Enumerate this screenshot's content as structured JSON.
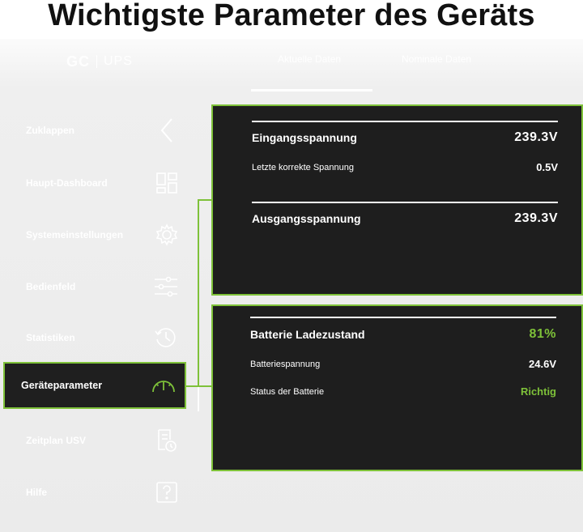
{
  "headline": "Wichtigste Parameter des Geräts",
  "app": {
    "logo_mark": "GC",
    "logo_text": "UPS",
    "tabs": [
      {
        "label": "Aktuelle Daten",
        "active": true
      },
      {
        "label": "Nominale Daten",
        "active": false
      }
    ]
  },
  "sidebar": {
    "items": [
      {
        "label": "Zuklappen",
        "icon": "chevron-left-icon"
      },
      {
        "label": "Haupt-Dashboard",
        "icon": "dashboard-grid-icon"
      },
      {
        "label": "Systemeinstellungen",
        "icon": "gear-icon"
      },
      {
        "label": "Bedienfeld",
        "icon": "sliders-icon"
      },
      {
        "label": "Statistiken",
        "icon": "history-clock-icon"
      },
      {
        "label": "Geräteparameter",
        "icon": "gauge-icon",
        "active": true
      },
      {
        "label": "Zeitplan USV",
        "icon": "schedule-document-icon"
      },
      {
        "label": "Hilfe",
        "icon": "help-question-icon"
      }
    ]
  },
  "voltage_panel": {
    "input_label": "Eingangsspannung",
    "input_value": "239.3V",
    "last_label": "Letzte korrekte Spannung",
    "last_value": "0.5V",
    "output_label": "Ausgangsspannung",
    "output_value": "239.3V"
  },
  "battery_panel": {
    "charge_label": "Batterie Ladezustand",
    "charge_value": "81%",
    "voltage_label": "Batteriespannung",
    "voltage_value": "24.6V",
    "status_label": "Status der Batterie",
    "status_value": "Richtig"
  },
  "colors": {
    "accent": "#7ec139",
    "panel_bg": "#1e1e1e",
    "app_bg": "#ebebeb"
  }
}
